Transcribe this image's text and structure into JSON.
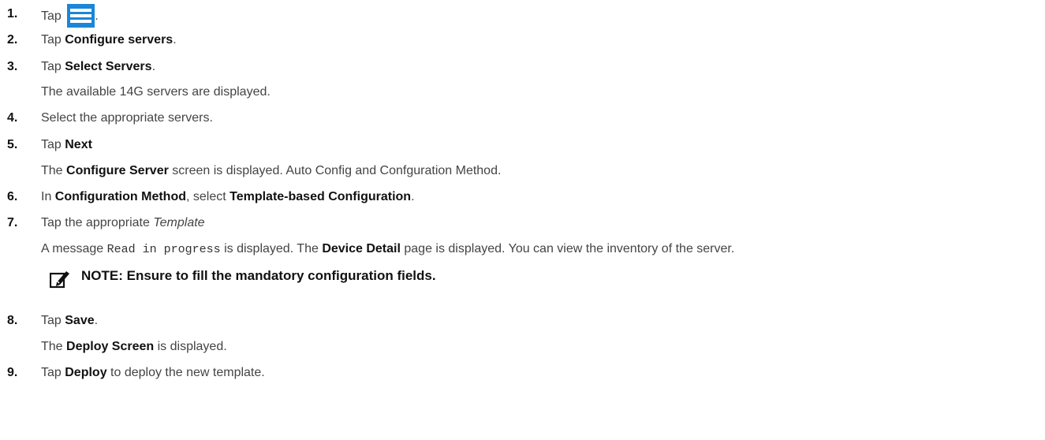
{
  "steps": [
    {
      "number": "1.",
      "tap": "Tap",
      "icon": "hamburger-menu-icon",
      "end": "."
    },
    {
      "number": "2.",
      "prefix": "Tap ",
      "bold": "Configure servers",
      "end": "."
    },
    {
      "number": "3.",
      "prefix": "Tap ",
      "bold": "Select Servers",
      "end": ".",
      "result": "The available 14G servers are displayed."
    },
    {
      "number": "4.",
      "text": "Select the appropriate servers."
    },
    {
      "number": "5.",
      "prefix": "Tap ",
      "bold": "Next",
      "result_prefix": "The ",
      "result_bold": "Configure Server",
      "result_suffix": " screen is displayed. Auto Config and Confguration Method."
    },
    {
      "number": "6.",
      "prefix": "In ",
      "bold1": "Configuration Method",
      "mid": ", select ",
      "bold2": "Template-based Configuration",
      "end": "."
    },
    {
      "number": "7.",
      "prefix": "Tap the appropriate ",
      "italic": "Template",
      "result_prefix": "A message ",
      "result_mono": "Read in progress",
      "result_mid": " is displayed. The ",
      "result_bold": "Device Detail",
      "result_suffix": " page is displayed. You can view the inventory of the server."
    },
    {
      "number": "8.",
      "prefix": "Tap ",
      "bold": "Save",
      "end": ".",
      "result_prefix": "The ",
      "result_bold": "Deploy Screen",
      "result_suffix": " is displayed."
    },
    {
      "number": "9.",
      "prefix": "Tap ",
      "bold": "Deploy",
      "suffix": " to deploy the new template."
    }
  ],
  "note": {
    "icon": "pencil-note-icon",
    "text": "NOTE: Ensure to fill the mandatory configuration fields."
  },
  "colors": {
    "icon_blue": "#1a86d8",
    "text": "#444444",
    "bold_text": "#111111"
  }
}
